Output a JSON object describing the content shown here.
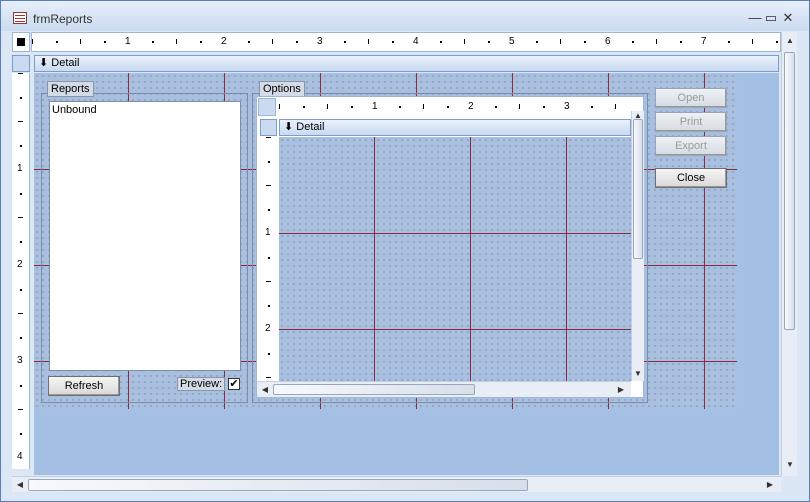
{
  "window": {
    "title": "frmReports",
    "minimize": "—",
    "maximize": "▭",
    "close": "✕"
  },
  "ruler": {
    "numbers": [
      "1",
      "2",
      "3",
      "4",
      "5",
      "6",
      "7"
    ]
  },
  "section": {
    "label": "Detail",
    "marker": "⬇"
  },
  "vruler": {
    "numbers": [
      "1",
      "2",
      "3",
      "4"
    ]
  },
  "reports": {
    "frame_label": "Reports",
    "list_value": "Unbound",
    "refresh_label": "Refresh",
    "preview_label": "Preview:",
    "preview_checked": "✔"
  },
  "options": {
    "frame_label": "Options",
    "ruler_numbers": [
      "1",
      "2",
      "3"
    ],
    "section_label": "Detail",
    "vruler_numbers": [
      "1",
      "2"
    ]
  },
  "buttons": {
    "open": "Open",
    "print": "Print",
    "export": "Export",
    "close": "Close"
  },
  "icons": {
    "form_icon": "form-icon",
    "section_marker": "down-arrow-icon"
  }
}
